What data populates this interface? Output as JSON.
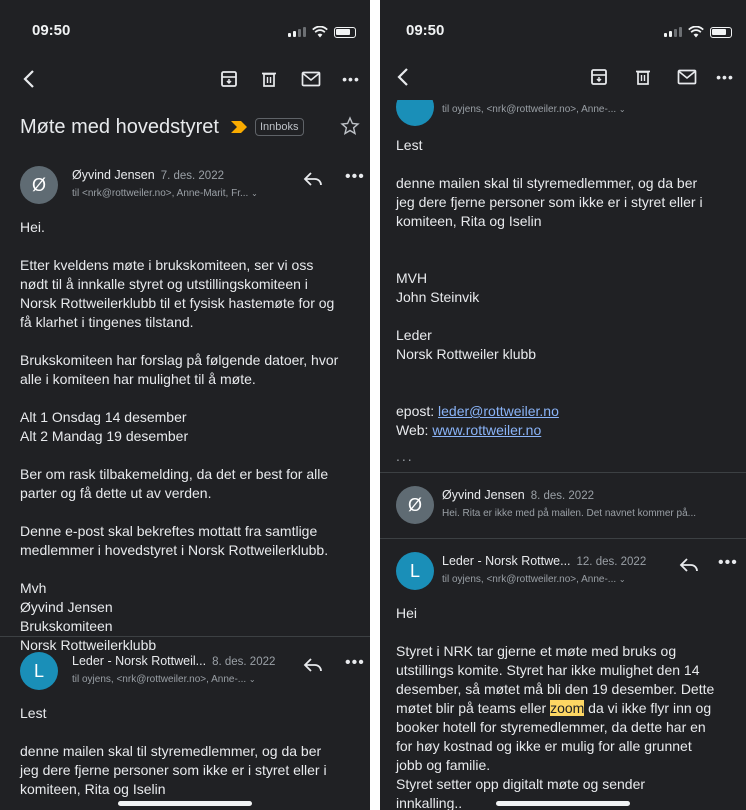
{
  "left": {
    "status_time": "09:50",
    "subject": "Møte med hovedstyret",
    "label_badge": "Innboks",
    "msg1": {
      "avatar_letter": "Ø",
      "avatar_color": "#5f6b73",
      "sender": "Øyvind Jensen",
      "date": "7. des. 2022",
      "recipients": "til <nrk@rottweiler.no>, Anne-Marit, Fr...",
      "p1": "Hei.",
      "p2": "Etter kveldens møte i brukskomiteen, ser vi oss\nnødt til å innkalle styret og utstillingskomiteen i\nNorsk Rottweilerklubb til et fysisk hastemøte for og\nfå klarhet i tingenes tilstand.",
      "p3": "Brukskomiteen har forslag på følgende datoer, hvor\nalle i komiteen har mulighet til å møte.",
      "p4": "Alt 1 Onsdag 14 desember\nAlt 2 Mandag 19 desember",
      "p5": "Ber om rask tilbakemelding, da det er best for alle\nparter og få dette ut av verden.",
      "p6": "Denne e-post skal bekreftes mottatt fra samtlige\nmedlemmer i hovedstyret i Norsk Rottweilerklubb.",
      "p7": "Mvh\nØyvind Jensen\nBrukskomiteen\nNorsk Rottweilerklubb"
    },
    "msg2": {
      "avatar_letter": "L",
      "avatar_color": "#1a8fb8",
      "sender": "Leder  - Norsk Rottweil...",
      "date": "8. des. 2022",
      "recipients": "til oyjens, <nrk@rottweiler.no>, Anne-...",
      "p1": "Lest",
      "p2": "denne mailen skal til styremedlemmer, og da ber\njeg dere fjerne personer som ikke er i styret eller i\nkomiteen, Rita og Iselin"
    }
  },
  "right": {
    "status_time": "09:50",
    "partial_recipients": "til oyjens, <nrk@rottweiler.no>, Anne-...",
    "p1": "Lest",
    "p2": "denne mailen skal til styremedlemmer, og da ber\njeg dere fjerne personer som ikke er i styret eller i\nkomiteen, Rita og Iselin",
    "p3": "MVH\nJohn Steinvik",
    "p4": "Leder\nNorsk Rottweiler klubb",
    "epost_label": "epost: ",
    "epost_link": "leder@rottweiler.no",
    "web_label": "Web: ",
    "web_link": "www.rottweiler.no",
    "ellipsis": "...",
    "collapsed": {
      "avatar_letter": "Ø",
      "avatar_color": "#5f6b73",
      "sender": "Øyvind Jensen",
      "date": "8. des. 2022",
      "snippet": "Hei. Rita er ikke med på mailen. Det navnet kommer på..."
    },
    "msg3": {
      "avatar_letter": "L",
      "avatar_color": "#1a8fb8",
      "sender": "Leder  - Norsk Rottwe...",
      "date": "12. des. 2022",
      "recipients": "til oyjens, <nrk@rottweiler.no>, Anne-...",
      "p1": "Hei",
      "p2_a": "Styret i NRK tar gjerne et møte med bruks og\nutstillings komite. Styret har ikke mulighet den 14\ndesember, så møtet må bli den 19 desember. Dette\nmøtet blir på teams eller ",
      "p2_hl": "zoom",
      "p2_b": " da vi ikke flyr inn og\nbooker hotell for styremedlemmer, da dette har en\nfor høy kostnad og ikke er mulig for alle grunnet\njobb og familie.\nStyret setter opp digitalt møte og sender\ninnkalling.."
    }
  }
}
